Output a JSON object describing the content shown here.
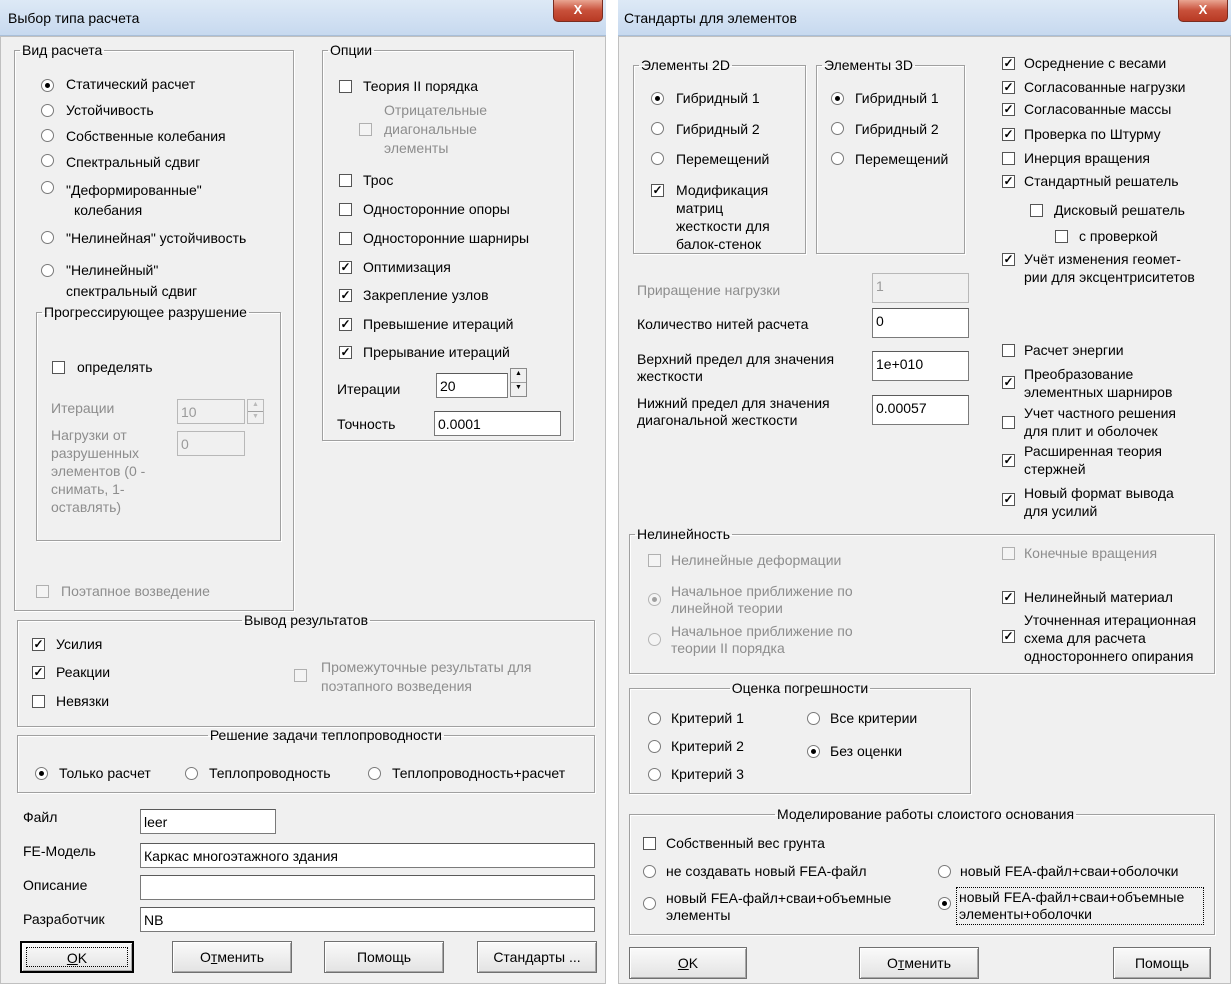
{
  "dlg1": {
    "title": "Выбор типа расчета",
    "close": "X",
    "vid": {
      "legend": "Вид расчета",
      "options": [
        "Статический расчет",
        "Устойчивость",
        "Собственные колебания",
        "Спектральный сдвиг",
        "\"Деформированные\"",
        "колебания",
        "\"Нелинейная\" устойчивость",
        "\"Нелинейный\"",
        "спектральный сдвиг"
      ]
    },
    "prog": {
      "legend": "Прогрессирующее разрушение",
      "determine": "определять",
      "iter_label": "Итерации",
      "iter_value": "10",
      "loads_label": [
        "Нагрузки от",
        "разрушенных",
        "элементов (0 -",
        "снимать, 1-",
        "оставлять)"
      ],
      "loads_value": "0"
    },
    "stage": "Поэтапное возведение",
    "options": {
      "legend": "Опции",
      "items": [
        "Теория II порядка",
        "Отрицательные",
        "диагональные",
        "элементы",
        "Трос",
        "Односторонние опоры",
        "Односторонние шарниры",
        "Оптимизация",
        "Закрепление узлов",
        "Превышение итераций",
        "Прерывание итераций"
      ],
      "iter_label": "Итерации",
      "iter_value": "20",
      "prec_label": "Точность",
      "prec_value": "0.0001"
    },
    "output": {
      "legend": "Вывод результатов",
      "items": [
        "Усилия",
        "Реакции",
        "Невязки"
      ],
      "intermediate": [
        "Промежуточные результаты для",
        "поэтапного возведения"
      ]
    },
    "heat": {
      "legend": "Решение задачи теплопроводности",
      "items": [
        "Только расчет",
        "Теплопроводность",
        "Теплопроводность+расчет"
      ]
    },
    "fields": {
      "file_label": "Файл",
      "file_value": "leer",
      "model_label": "FE-Модель",
      "model_value": "Каркас многоэтажного здания",
      "desc_label": "Описание",
      "desc_value": "",
      "dev_label": "Разработчик",
      "dev_value": "NB"
    },
    "buttons": {
      "ok_u": "O",
      "ok_rest": "K",
      "cancel_a": "О",
      "cancel_u": "т",
      "cancel_rest": "менить",
      "help": "Помощь",
      "standards": "Стандарты ..."
    }
  },
  "dlg2": {
    "title": "Стандарты для элементов",
    "close": "X",
    "e2d": {
      "legend": "Элементы 2D",
      "items": [
        "Гибридный 1",
        "Гибридный 2",
        "Перемещений"
      ],
      "mod": [
        "Модификация",
        "матриц",
        "жесткости  для",
        "балок-стенок"
      ]
    },
    "e3d": {
      "legend": "Элементы 3D",
      "items": [
        "Гибридный 1",
        "Гибридный 2",
        "Перемещений"
      ]
    },
    "right": [
      "Осреднение с весами",
      "Согласованные нагрузки",
      "Согласованные массы",
      "Проверка  по  Штурму",
      "Инерция  вращения",
      "Стандартный решатель",
      "Дисковый решатель",
      "с проверкой",
      "Учёт изменения геомет-",
      "рии для эксцентриситетов"
    ],
    "params": {
      "inc_label": "Приращение нагрузки",
      "inc_value": "1",
      "threads_label": "Количество нитей расчета",
      "threads_value": "0",
      "upper_label": [
        "Верхний предел для значения",
        "жесткости"
      ],
      "upper_value": "1e+010",
      "lower_label": [
        "Нижний предел для значения",
        "диагональной жесткости"
      ],
      "lower_value": "0.00057"
    },
    "right2": [
      "Расчет энергии",
      "Преобразование",
      "элементных шарниров",
      "Учет частного решения",
      "для плит и оболочек",
      "Расширенная теория",
      "стержней",
      "Новый формат вывода",
      "для усилий"
    ],
    "nonlin": {
      "legend": "Нелинейность",
      "items": [
        "Нелинейные деформации",
        "Начальное приближение по",
        "линейной теории",
        "Начальное приближение по",
        "теории II порядка",
        "Конечные вращения",
        "Нелинейный материал",
        "Уточненная итерационная",
        "схема для расчета",
        "одностороннего опирания"
      ]
    },
    "error": {
      "legend": "Оценка погрешности",
      "items": [
        "Критерий  1",
        "Критерий 2",
        "Критерий 3",
        "Все критерии",
        "Без оценки"
      ]
    },
    "soil": {
      "legend": "Моделирование работы слоистого основания",
      "items": [
        "Собственный вес грунта",
        "не создавать новый FEA-файл",
        "новый FEA-файл+сваи+оболочки",
        "новый FEA-файл+сваи+объемные",
        "элементы",
        "новый FEA-файл+сваи+объемные",
        "элементы+оболочки"
      ]
    },
    "buttons": {
      "ok_u": "O",
      "ok_rest": "K",
      "cancel_a": "О",
      "cancel_u": "т",
      "cancel_rest": "менить",
      "help": "Помощь"
    }
  }
}
